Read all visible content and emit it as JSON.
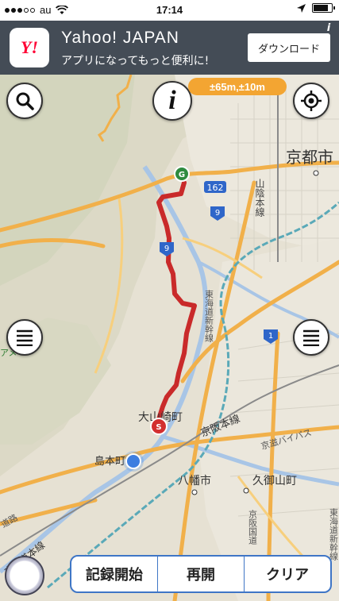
{
  "status_bar": {
    "carrier": "au",
    "time": "17:14",
    "signal_strength": "3/5"
  },
  "ad_banner": {
    "logo_text": "Y!",
    "title": "Yahoo! JAPAN",
    "subtitle": "アプリになってもっと便利に!",
    "download_label": "ダウンロード",
    "info_label": "i"
  },
  "map": {
    "accuracy_badge": "±65m,±10m",
    "info_button_label": "i",
    "place_labels": {
      "kyoto_city": "京都市",
      "oyamazaki_town": "大山崎町",
      "shimamoto_town": "島本町",
      "yawata_city": "八幡市",
      "kumiyama_town": "久御山町",
      "sanin_line": "山陰本線",
      "tokaido_shinkansen_1": "東海道新幹線",
      "tokaido_shinkansen_2": "東海道新幹線",
      "keihan_line": "京阪本線",
      "keiji_bypass": "京滋バイパス",
      "tokaido_main_line": "東海道本線",
      "road_label": "道路",
      "keihan_expressway": "京阪国道",
      "ame_label": "アメ"
    },
    "route_shields": {
      "r162": "162",
      "r9a": "9",
      "r9b": "9",
      "r1": "1"
    },
    "markers": {
      "goal": "G",
      "start": "S"
    }
  },
  "bottom_bar": {
    "start_record": "記録開始",
    "resume": "再開",
    "clear": "クリア"
  },
  "icons": [
    "search-icon",
    "locate-icon",
    "menu-icon",
    "info-icon",
    "wifi-icon",
    "location-arrow-icon",
    "battery-icon",
    "compass-icon"
  ]
}
